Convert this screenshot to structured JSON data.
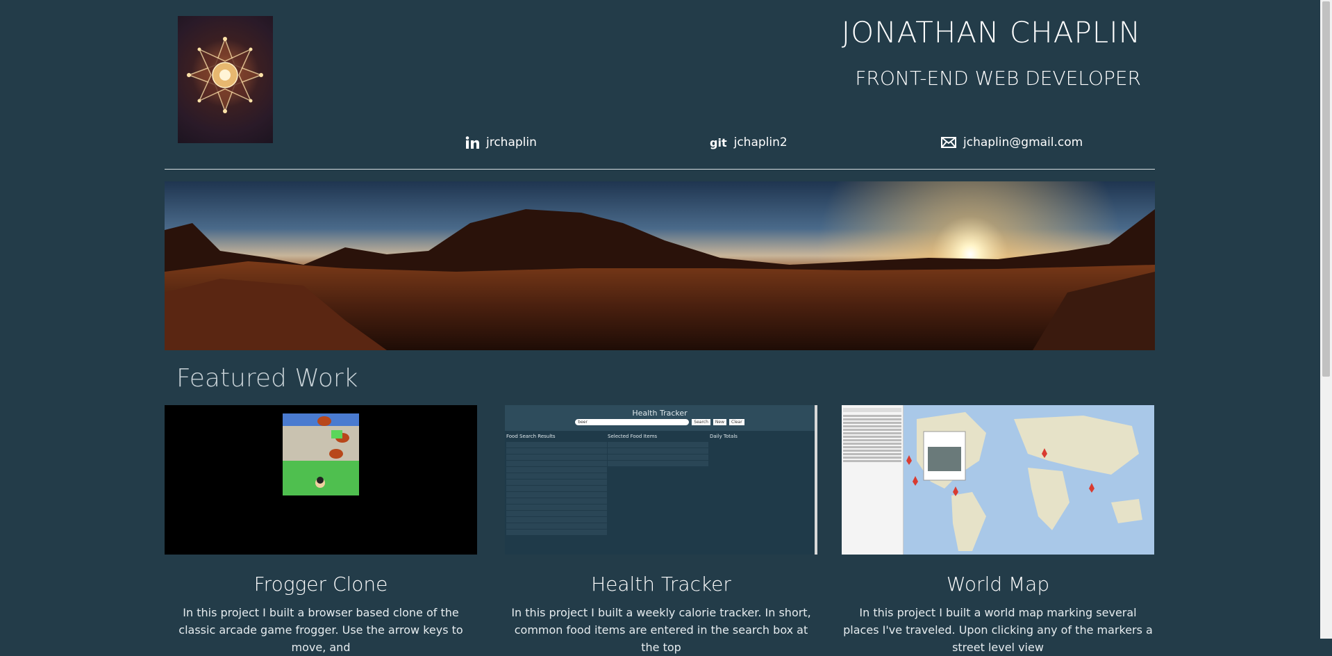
{
  "header": {
    "name": "JONATHAN CHAPLIN",
    "subtitle": "FRONT-END WEB DEVELOPER",
    "profile_image": "profile-photo",
    "contacts": {
      "linkedin": {
        "icon": "linkedin-icon",
        "label": "jrchaplin"
      },
      "git": {
        "icon": "git-icon",
        "icon_text": "git",
        "label": "jchaplin2"
      },
      "email": {
        "icon": "envelope-icon",
        "label": "jchaplin@gmail.com"
      }
    }
  },
  "banner": {
    "image": "desert-sunset-panorama"
  },
  "featured": {
    "title": "Featured Work",
    "projects": [
      {
        "title": "Frogger Clone",
        "image": "frogger-screenshot",
        "description": "In this project I built a browser based clone of the classic arcade game frogger. Use the arrow keys to move, and"
      },
      {
        "title": "Health Tracker",
        "image": "health-tracker-screenshot",
        "description": "In this project I built a weekly calorie tracker. In short, common food items are entered in the search box at the top",
        "screenshot_text": {
          "app_title": "Health Tracker",
          "search_value": "beer",
          "search_button": "Search",
          "new_button": "New",
          "clear_button": "Clear",
          "col1": "Food Search Results",
          "col2": "Selected Food Items",
          "col3": "Daily Totals"
        }
      },
      {
        "title": "World Map",
        "image": "world-map-screenshot",
        "description": "In this project I built a world map marking several places I've traveled. Upon clicking any of the markers a street level view"
      }
    ]
  },
  "colors": {
    "background": "#233c49",
    "text": "#ffffff",
    "section_title": "#c9d3d8"
  }
}
